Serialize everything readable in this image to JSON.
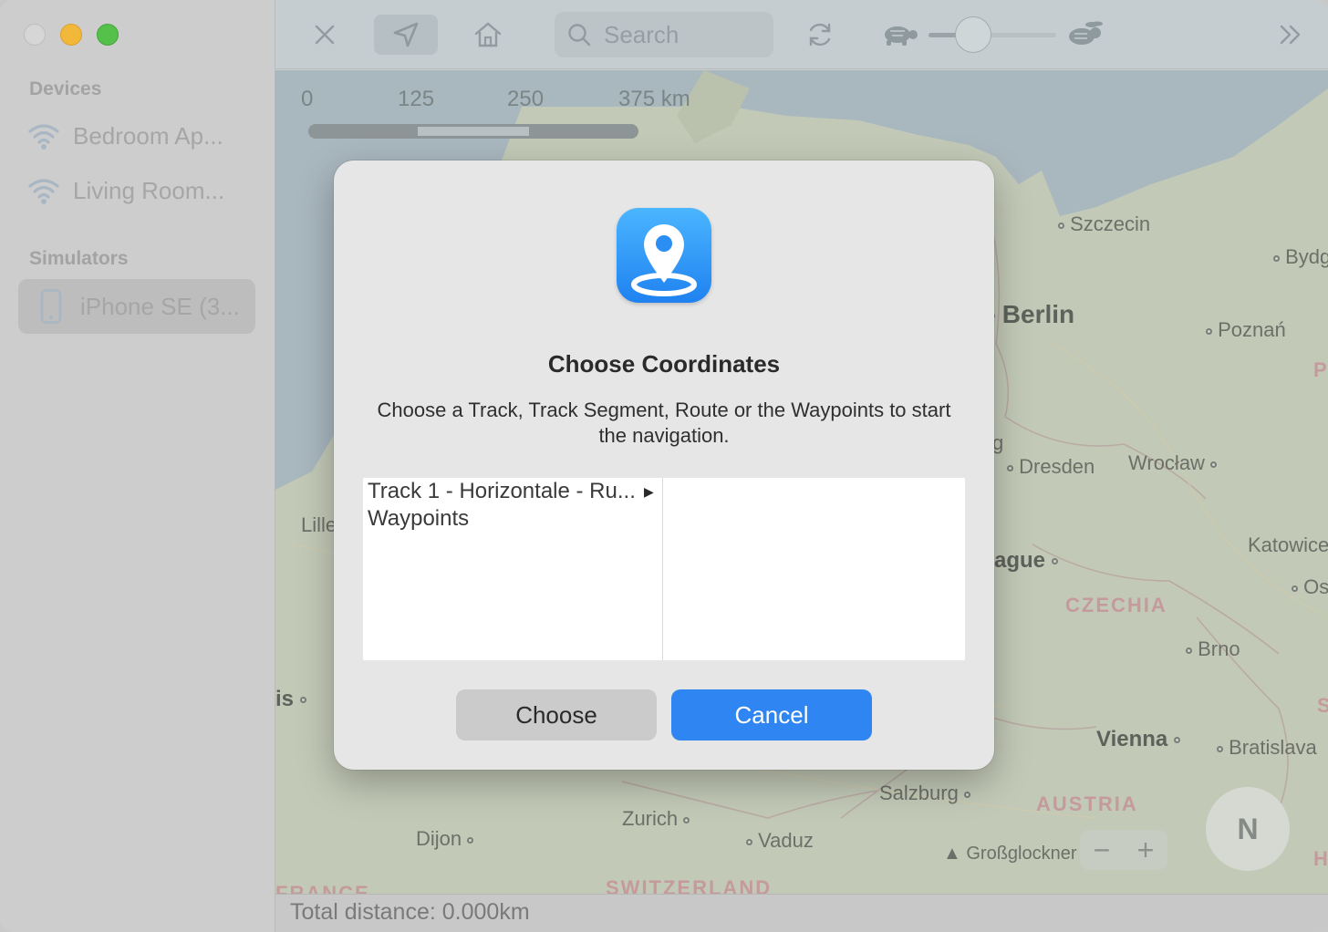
{
  "sidebar": {
    "devices_header": "Devices",
    "devices": [
      {
        "label": "Bedroom Ap...",
        "icon": "wifi-icon"
      },
      {
        "label": "Living Room...",
        "icon": "wifi-icon"
      }
    ],
    "simulators_header": "Simulators",
    "simulators": [
      {
        "label": "iPhone SE (3...",
        "icon": "iphone-icon",
        "selected": true
      }
    ]
  },
  "toolbar": {
    "search_placeholder": "Search",
    "speed_slider_value": 0.35
  },
  "map": {
    "scale": {
      "labels": [
        "0",
        "125",
        "250",
        "375 km"
      ]
    },
    "cities": {
      "szczecin": "Szczecin",
      "bydg": "Bydg",
      "berlin": "Berlin",
      "poznan": "Poznań",
      "dresden": "Dresden",
      "wroclaw": "Wrocław",
      "katowice": "Katowice",
      "prague": "ague",
      "os": "Os",
      "brno": "Brno",
      "vienna": "Vienna",
      "bratislava": "Bratislava",
      "salzburg": "Salzburg",
      "zurich": "Zurich",
      "vaduz": "Vaduz",
      "dijon": "Dijon",
      "grossglockner": "Großglockner",
      "lille": "Lille",
      "paris": "is",
      "g": "g"
    },
    "countries": {
      "czechia": "CZECHIA",
      "austria": "AUSTRIA",
      "switzerland": "SWITZERLAND",
      "france": "FRANCE",
      "p": "P",
      "s": "S",
      "h": "H"
    },
    "zoom_minus": "−",
    "zoom_plus": "+",
    "compass_label": "N"
  },
  "statusbar": {
    "total_distance": "Total distance: 0.000km"
  },
  "dialog": {
    "title": "Choose Coordinates",
    "message": "Choose a Track, Track Segment, Route or the Waypoints to start the navigation.",
    "items": [
      {
        "label": "Track 1 - Horizontale - Ru...",
        "has_children": true
      },
      {
        "label": "Waypoints",
        "has_children": false
      }
    ],
    "choose_label": "Choose",
    "cancel_label": "Cancel"
  }
}
